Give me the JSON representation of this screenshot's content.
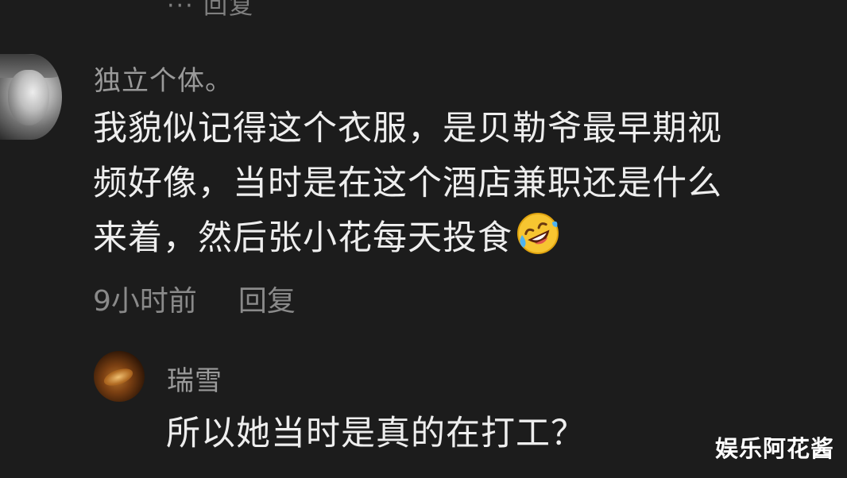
{
  "top_fragment": "··· 回复",
  "comments": [
    {
      "username": "独立个体。",
      "lines": [
        "我貌似记得这个衣服，是贝勒爷最早期视",
        "频好像，当时是在这个酒店兼职还是什么",
        "来着，然后张小花每天投食"
      ],
      "emoji": "rolling-on-floor-laughing-icon",
      "time": "9小时前",
      "reply_label": "回复"
    },
    {
      "username": "瑞雪",
      "text": "所以她当时是真的在打工？"
    }
  ],
  "watermark": "娱乐阿花酱"
}
